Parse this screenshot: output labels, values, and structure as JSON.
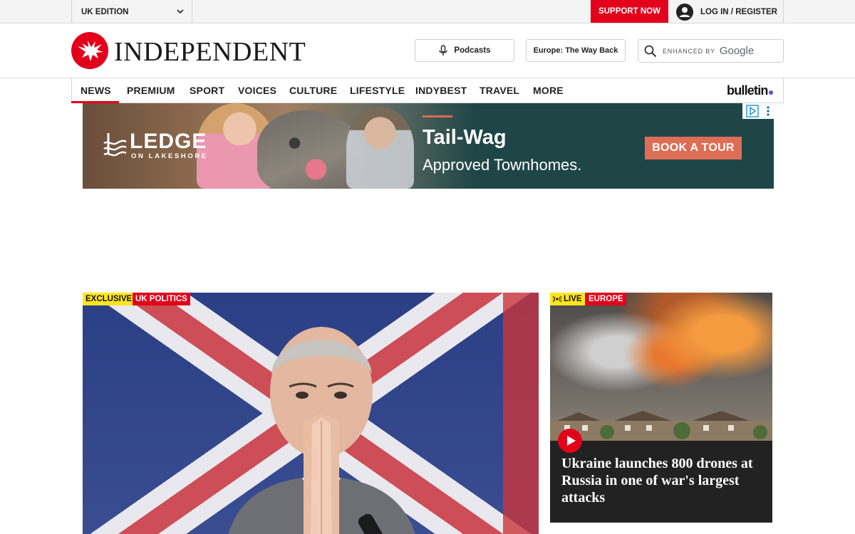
{
  "utility": {
    "edition": "UK EDITION",
    "support_label": "SUPPORT NOW",
    "login_label": "LOG IN / REGISTER"
  },
  "masthead": {
    "logo_text": "INDEPENDENT",
    "podcasts_label": "Podcasts",
    "europe_label": "Europe: The Way Back",
    "search": {
      "enhanced_by": "ENHANCED BY",
      "provider": "Google"
    }
  },
  "nav": {
    "items": [
      {
        "label": "NEWS",
        "active": true
      },
      {
        "label": "PREMIUM"
      },
      {
        "label": "SPORT"
      },
      {
        "label": "VOICES"
      },
      {
        "label": "CULTURE"
      },
      {
        "label": "LIFESTYLE"
      },
      {
        "label": "INDYBEST"
      },
      {
        "label": "TRAVEL"
      },
      {
        "label": "MORE"
      }
    ],
    "bulletin_label": "bulletin"
  },
  "ad": {
    "brand": "LEDGE",
    "brand_sub": "ON LAKESHORE",
    "headline": "Tail-Wag",
    "subline": "Approved Townhomes.",
    "cta": "BOOK A TOUR"
  },
  "hero": {
    "tag_exclusive": "EXCLUSIVE",
    "tag_section": "UK POLITICS"
  },
  "side_story": {
    "tag_live": "LIVE",
    "tag_section": "EUROPE",
    "headline": "Ukraine launches 800 drones at Russia in one of war's largest attacks"
  },
  "colors": {
    "brand_red": "#e2001a",
    "tag_yellow": "#ffe61e",
    "ad_teal": "#1f4647",
    "ad_cta": "#dd6e55",
    "bulletin_dot": "#5b4fe0"
  }
}
